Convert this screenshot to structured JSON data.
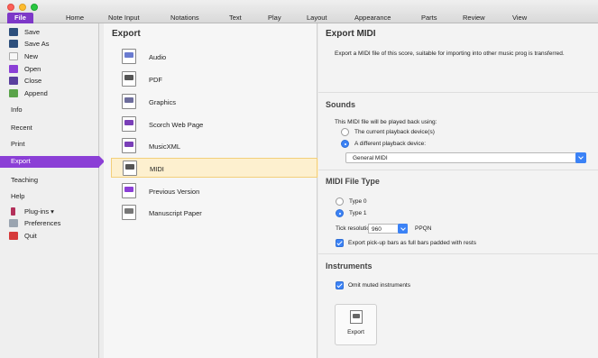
{
  "tabs": [
    "File",
    "Home",
    "Note Input",
    "Notations",
    "Text",
    "Play",
    "Layout",
    "Appearance",
    "Parts",
    "Review",
    "View"
  ],
  "sidebar": {
    "items": [
      {
        "label": "Save",
        "icon": "save-icon",
        "color": "#2d4f7c",
        "type": "file"
      },
      {
        "label": "Save As",
        "icon": "save-as-icon",
        "color": "#2d4f7c",
        "type": "file"
      },
      {
        "label": "New",
        "icon": "new-icon",
        "color": "#e8e8e8",
        "type": "file"
      },
      {
        "label": "Open",
        "icon": "folder-icon",
        "color": "#8b3fd6",
        "type": "file"
      },
      {
        "label": "Close",
        "icon": "folder-close-icon",
        "color": "#5a3f9e",
        "type": "file"
      },
      {
        "label": "Append",
        "icon": "append-icon",
        "color": "#5aa34a",
        "type": "file"
      },
      {
        "label": "Info",
        "type": "section"
      },
      {
        "label": "Recent",
        "type": "section"
      },
      {
        "label": "Print",
        "type": "section"
      },
      {
        "label": "Export",
        "type": "section",
        "active": true
      },
      {
        "label": "Teaching",
        "type": "section"
      },
      {
        "label": "Help",
        "type": "section"
      },
      {
        "label": "Plug-ins ▾",
        "icon": "plugin-icon",
        "color": "#b3305a",
        "type": "file"
      },
      {
        "label": "Preferences",
        "icon": "preferences-icon",
        "color": "#9aa4b0",
        "type": "file"
      },
      {
        "label": "Quit",
        "icon": "quit-icon",
        "color": "#d63a3a",
        "type": "file"
      }
    ]
  },
  "export_list": {
    "title": "Export",
    "items": [
      {
        "label": "Audio",
        "icon": "audio-icon",
        "color": "#6a7bd0"
      },
      {
        "label": "PDF",
        "icon": "pdf-icon",
        "color": "#555555"
      },
      {
        "label": "Graphics",
        "icon": "graphics-icon",
        "color": "#6d6d9c"
      },
      {
        "label": "Scorch Web Page",
        "icon": "scorch-web-page-icon",
        "color": "#7a3fb8"
      },
      {
        "label": "MusicXML",
        "icon": "musicxml-icon",
        "color": "#7a3fb8"
      },
      {
        "label": "MIDI",
        "icon": "midi-icon",
        "color": "#555555",
        "active": true
      },
      {
        "label": "Previous Version",
        "icon": "previous-version-icon",
        "color": "#8b3fd6"
      },
      {
        "label": "Manuscript Paper",
        "icon": "manuscript-paper-icon",
        "color": "#777777"
      }
    ]
  },
  "detail": {
    "title": "Export MIDI",
    "description": "Export a MIDI file of this score, suitable for importing into other music prog is transferred.",
    "sounds": {
      "heading": "Sounds",
      "prompt": "This MIDI file will be played back using:",
      "option_current": "The current playback device(s)",
      "option_different": "A different playback device:",
      "device": "General MIDI"
    },
    "file_type": {
      "heading": "MIDI File Type",
      "type0": "Type 0",
      "type1": "Type 1",
      "tick_label": "Tick resolution:",
      "tick_value": "960",
      "tick_unit": "PPQN",
      "pickup_label": "Export pick-up bars as full bars padded with rests"
    },
    "instruments": {
      "heading": "Instruments",
      "omit_label": "Omit muted instruments"
    },
    "export_button": "Export"
  },
  "colors": {
    "accent": "#8b3fd6",
    "selection": "#fdf0cf",
    "control": "#3b82f6"
  }
}
